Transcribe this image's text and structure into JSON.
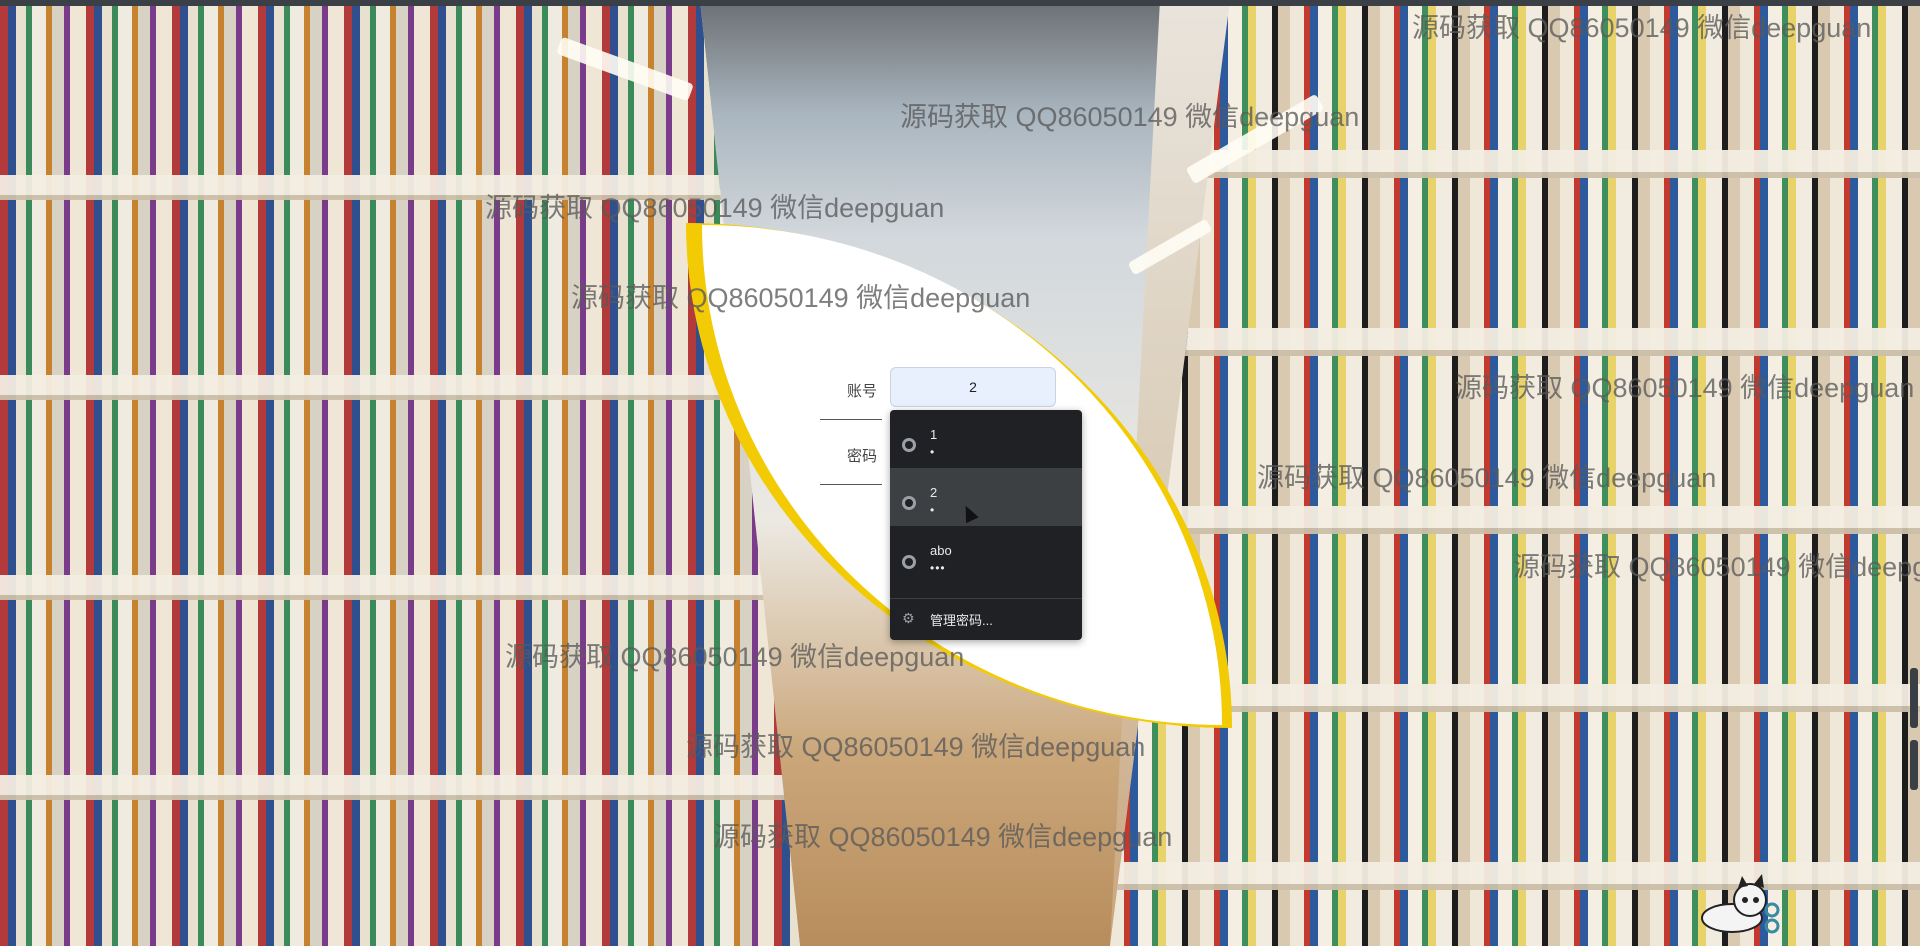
{
  "login": {
    "account_label": "账号",
    "password_label": "密码",
    "account_value": "2"
  },
  "autofill": {
    "entries": [
      {
        "username": "1",
        "password_mask": "•"
      },
      {
        "username": "2",
        "password_mask": "•"
      },
      {
        "username": "abo",
        "password_mask": "•••"
      }
    ],
    "manage_label": "管理密码..."
  },
  "watermark_text": "源码获取 QQ86050149 微信deepguan",
  "colors": {
    "card_accent": "#f2cb05",
    "input_fill": "#e8f0fe",
    "dropdown_bg": "#202124",
    "dropdown_hover": "#3c4043"
  },
  "icons": {
    "entry_icon": "globe-icon",
    "manage_icon": "gear-icon"
  }
}
